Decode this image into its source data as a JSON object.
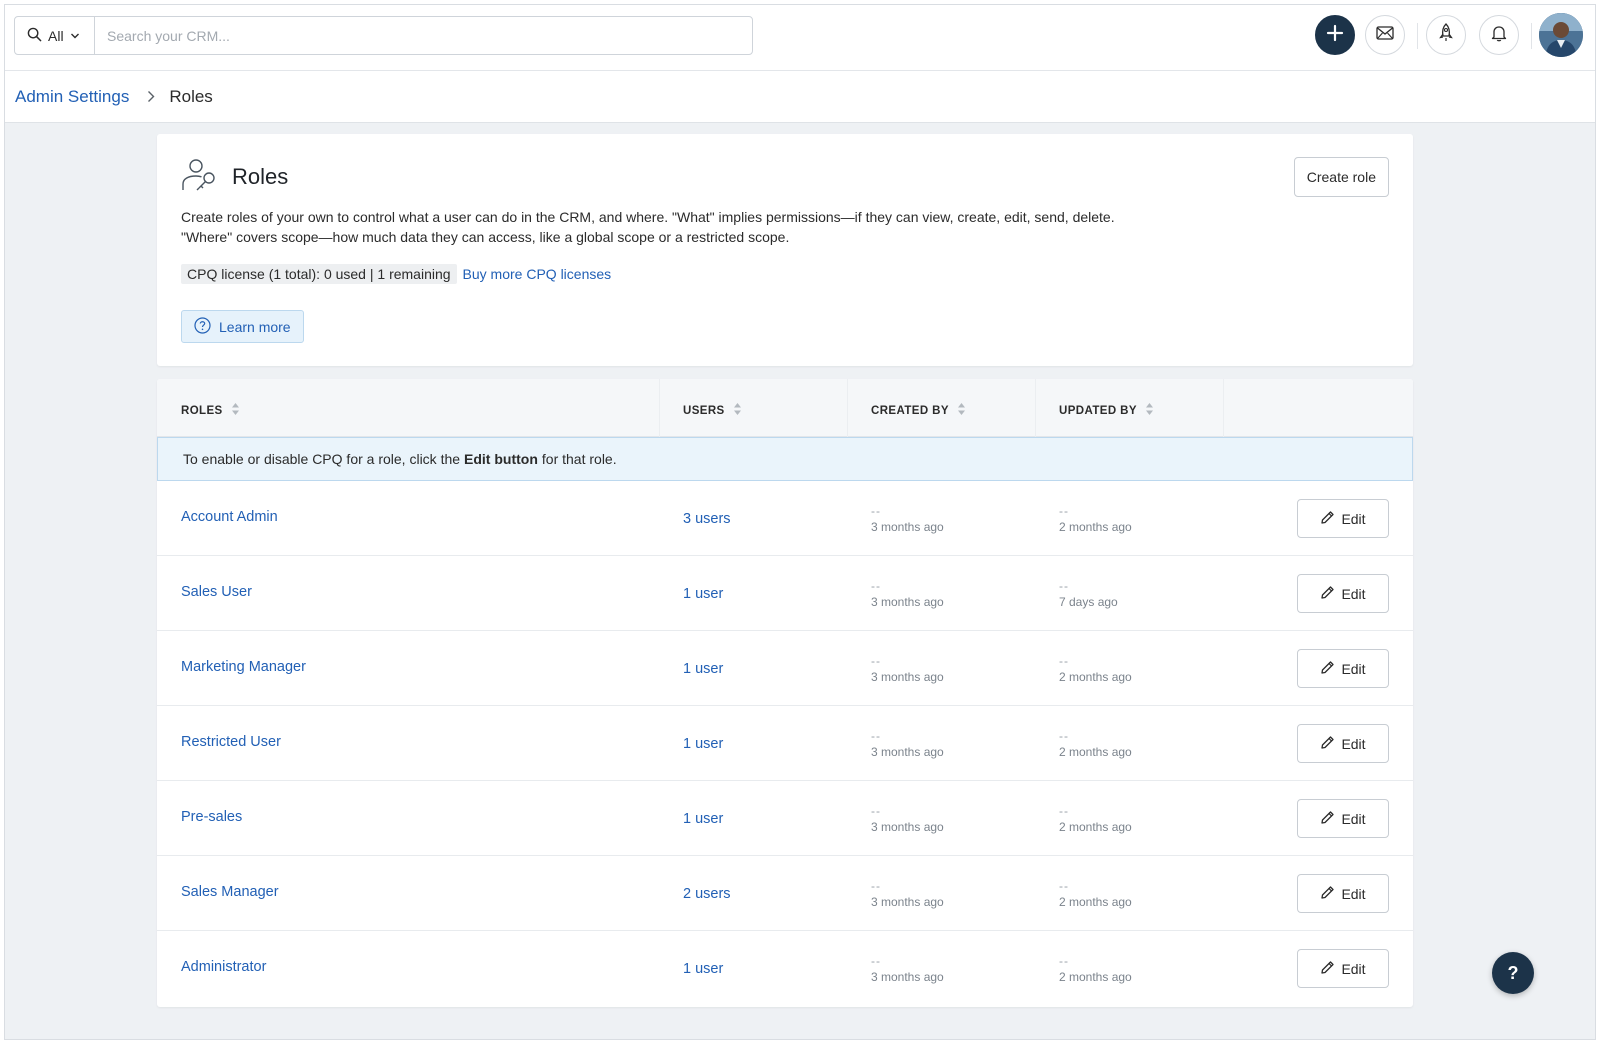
{
  "search": {
    "scope_value": "All",
    "placeholder": "Search your CRM..."
  },
  "breadcrumb": {
    "parent": "Admin Settings",
    "current": "Roles"
  },
  "header": {
    "title": "Roles",
    "create_button": "Create role",
    "description": "Create roles of your own to control what a user can do in the CRM, and where. \"What\" implies permissions—if they can view, create, edit, send, delete. \"Where\" covers scope—how much data they can access, like a global scope or a restricted scope.",
    "license_text": "CPQ license (1 total): 0 used | 1 remaining",
    "buy_link": "Buy more CPQ licenses",
    "learn_more": "Learn more"
  },
  "table": {
    "columns": [
      "ROLES",
      "USERS",
      "CREATED BY",
      "UPDATED BY"
    ],
    "notice_prefix": "To enable or disable CPQ for a role, click the",
    "notice_bold": "Edit button",
    "notice_suffix": "for that role.",
    "edit_label": "Edit",
    "rows": [
      {
        "role": "Account Admin",
        "users": "3 users",
        "created_by": "--",
        "created_at": "3 months ago",
        "updated_by": "--",
        "updated_at": "2 months ago"
      },
      {
        "role": "Sales User",
        "users": "1 user",
        "created_by": "--",
        "created_at": "3 months ago",
        "updated_by": "--",
        "updated_at": "7 days ago"
      },
      {
        "role": "Marketing Manager",
        "users": "1 user",
        "created_by": "--",
        "created_at": "3 months ago",
        "updated_by": "--",
        "updated_at": "2 months ago"
      },
      {
        "role": "Restricted User",
        "users": "1 user",
        "created_by": "--",
        "created_at": "3 months ago",
        "updated_by": "--",
        "updated_at": "2 months ago"
      },
      {
        "role": "Pre-sales",
        "users": "1 user",
        "created_by": "--",
        "created_at": "3 months ago",
        "updated_by": "--",
        "updated_at": "2 months ago"
      },
      {
        "role": "Sales Manager",
        "users": "2 users",
        "created_by": "--",
        "created_at": "3 months ago",
        "updated_by": "--",
        "updated_at": "2 months ago"
      },
      {
        "role": "Administrator",
        "users": "1 user",
        "created_by": "--",
        "created_at": "3 months ago",
        "updated_by": "--",
        "updated_at": "2 months ago"
      }
    ]
  },
  "help": {
    "label": "?"
  },
  "colors": {
    "link": "#2260b5",
    "navy": "#1c3349",
    "page_bg": "#eef1f4",
    "notice_bg": "#eaf4fb"
  },
  "icons": [
    "search-icon",
    "chevron-down-icon",
    "plus-icon",
    "mail-icon",
    "rocket-icon",
    "bell-icon",
    "chevron-right-icon",
    "roles-icon",
    "help-circle-icon",
    "sort-icon",
    "pencil-icon"
  ]
}
